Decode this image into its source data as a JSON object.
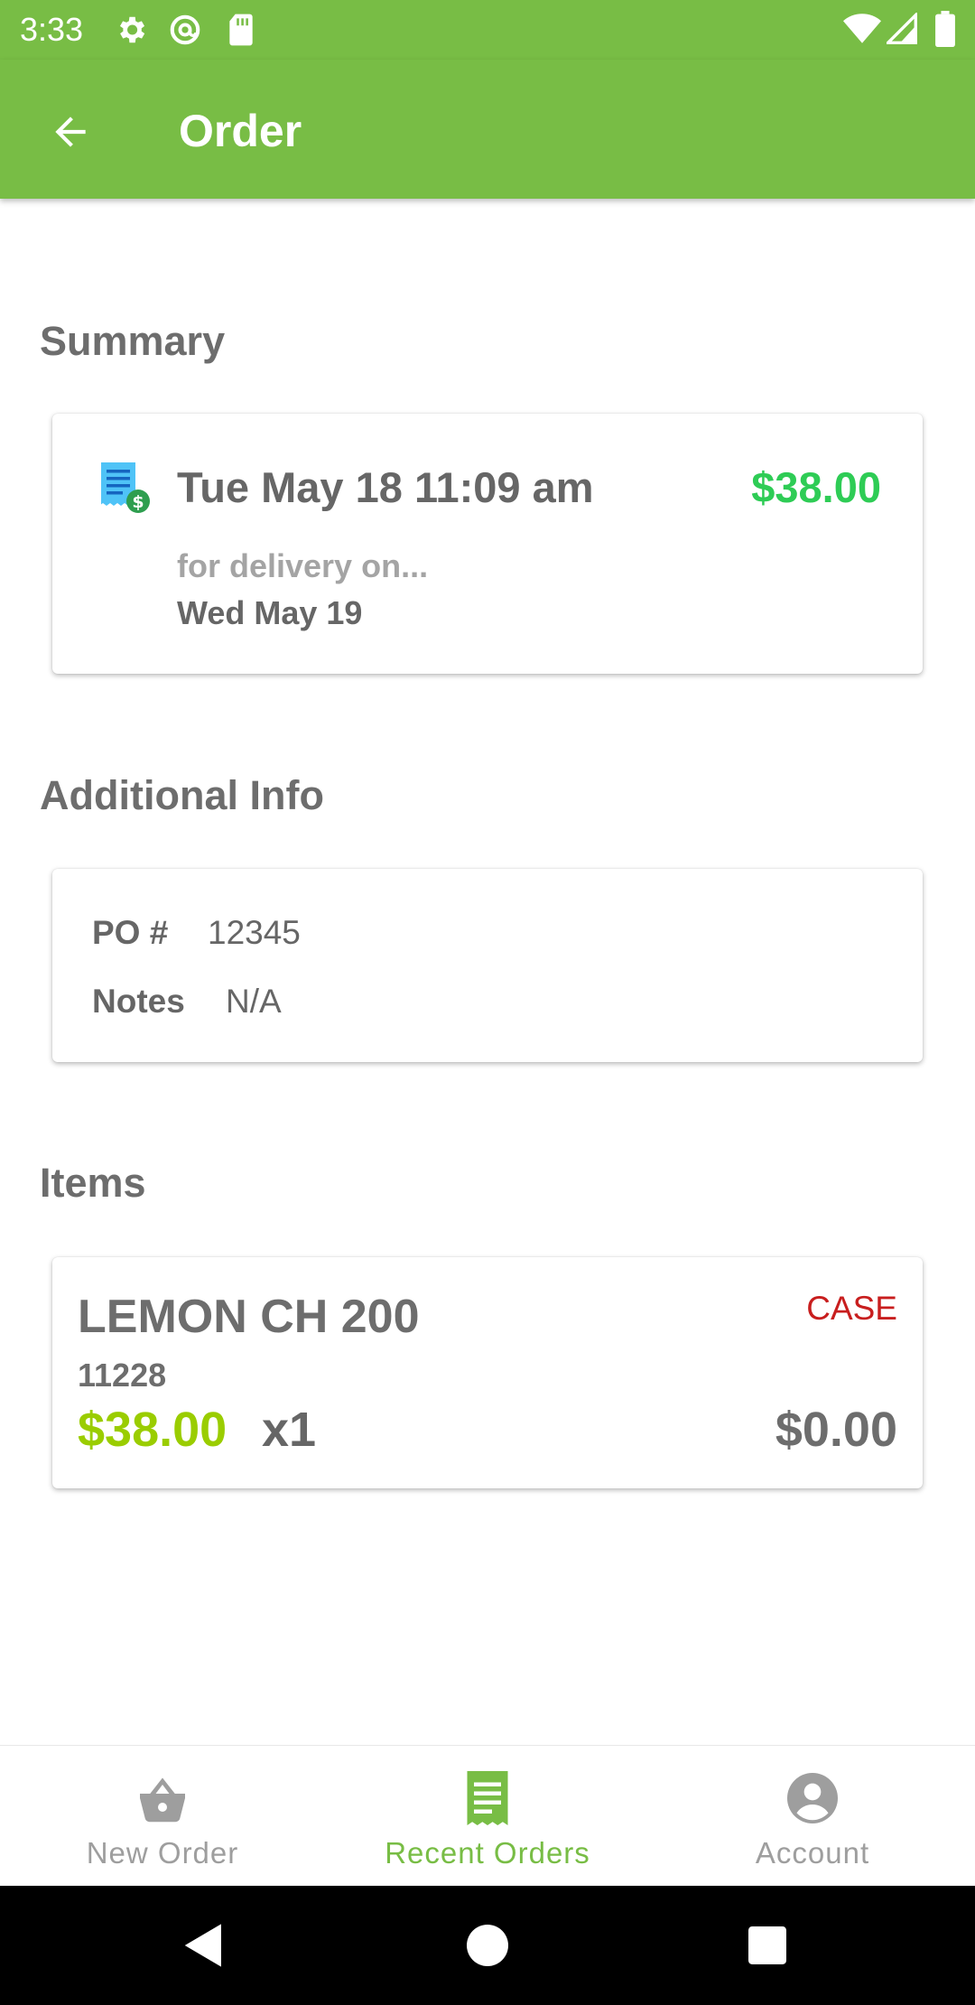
{
  "status_bar": {
    "time": "3:33",
    "icons": [
      "settings-icon",
      "at-sign-icon",
      "sd-card-icon",
      "wifi-icon",
      "signal-icon",
      "battery-icon"
    ]
  },
  "app_bar": {
    "title": "Order",
    "back_icon": "arrow-left-icon",
    "color": "#78bd45"
  },
  "summary": {
    "section_title": "Summary",
    "icon": "receipt-dollar-icon",
    "order_date": "Tue May 18 11:09 am",
    "total": "$38.00",
    "delivery_label": "for delivery on...",
    "delivery_date": "Wed May 19"
  },
  "additional_info": {
    "section_title": "Additional Info",
    "po_label": "PO #",
    "po_value": "12345",
    "notes_label": "Notes",
    "notes_value": "N/A"
  },
  "items": {
    "section_title": "Items",
    "list": [
      {
        "name": "LEMON CH 200",
        "unit": "CASE",
        "code": "11228",
        "price": "$38.00",
        "quantity": "x1",
        "line_total": "$0.00"
      }
    ]
  },
  "bottom_nav": {
    "items": [
      {
        "label": "New Order",
        "icon": "basket-icon",
        "active": false
      },
      {
        "label": "Recent Orders",
        "icon": "receipt-icon",
        "active": true
      },
      {
        "label": "Account",
        "icon": "account-circle-icon",
        "active": false
      }
    ]
  },
  "colors": {
    "primary": "#78bd45",
    "total_green": "#2ecc55",
    "price_lime": "#9acd00",
    "unit_red": "#c81e1e"
  }
}
